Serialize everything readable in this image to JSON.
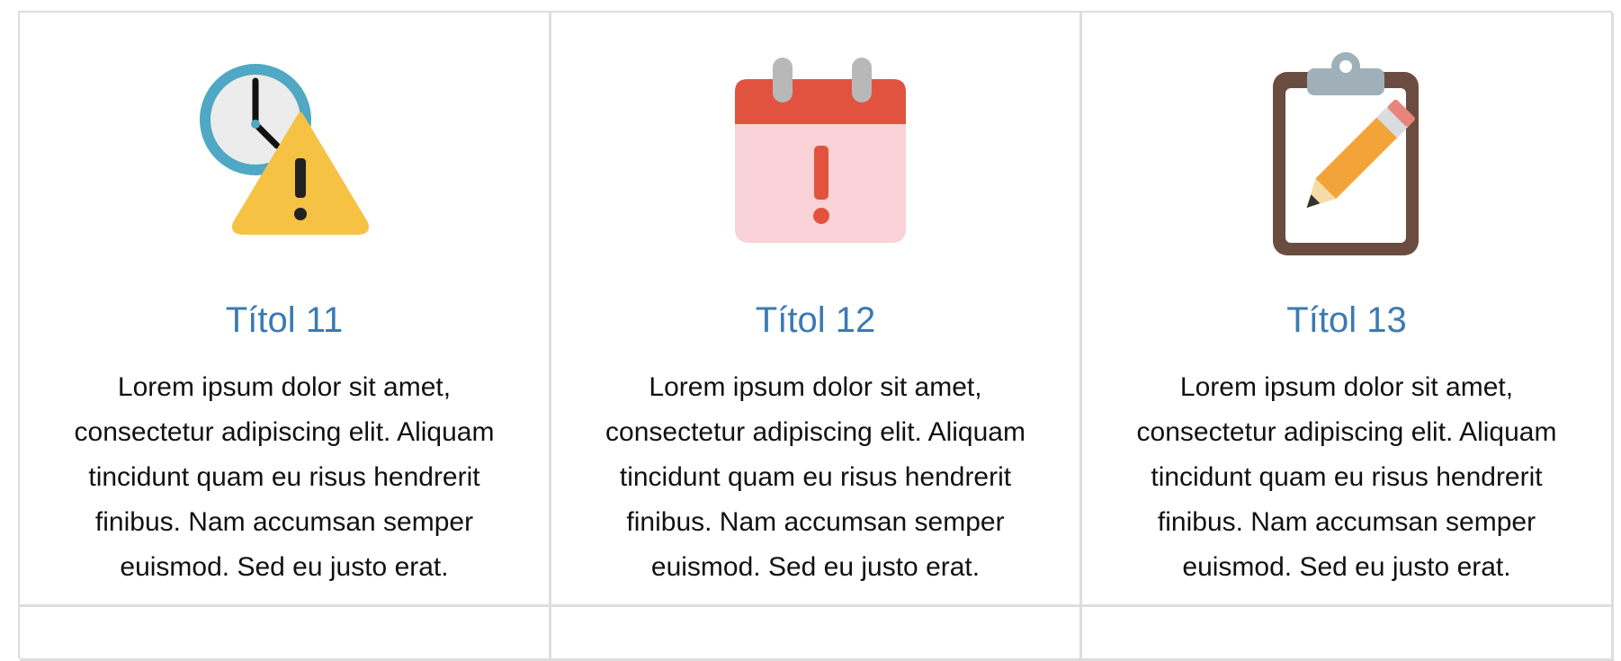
{
  "cards": [
    {
      "icon": "clock-warning-icon",
      "title": "Títol 11",
      "text": "Lorem ipsum dolor sit amet, consectetur adipiscing elit. Aliquam tincidunt quam eu risus hendrerit finibus. Nam accumsan semper euismod. Sed eu justo erat."
    },
    {
      "icon": "calendar-alert-icon",
      "title": "Títol 12",
      "text": "Lorem ipsum dolor sit amet, consectetur adipiscing elit. Aliquam tincidunt quam eu risus hendrerit finibus. Nam accumsan semper euismod. Sed eu justo erat."
    },
    {
      "icon": "clipboard-pencil-icon",
      "title": "Títol 13",
      "text": "Lorem ipsum dolor sit amet, consectetur adipiscing elit. Aliquam tincidunt quam eu risus hendrerit finibus. Nam accumsan semper euismod. Sed eu justo erat."
    }
  ],
  "colors": {
    "title": "#3b7ab3",
    "border": "#dddddd",
    "clock_ring": "#4fa8c4",
    "warning": "#f5c244",
    "calendar_header": "#e2533f",
    "calendar_body": "#f8d2d6",
    "clipboard": "#6b4c40",
    "pencil": "#f2a33a"
  }
}
